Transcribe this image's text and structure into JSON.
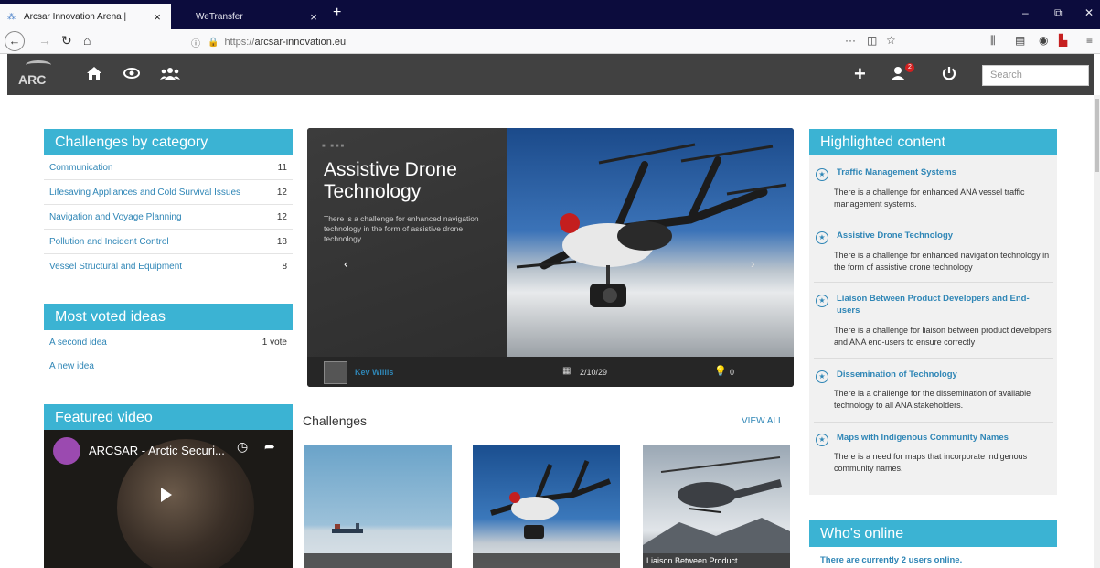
{
  "browser": {
    "tabs": [
      {
        "title": "Arcsar Innovation Arena |",
        "active": true
      },
      {
        "title": "WeTransfer",
        "active": false
      }
    ],
    "url_protocol": "https://",
    "url_host": "arcsar-innovation.eu",
    "url_more": "···"
  },
  "header": {
    "logo_text": "ARC",
    "search_placeholder": "Search",
    "notification_count": "2"
  },
  "categories": {
    "title": "Challenges by category",
    "items": [
      {
        "name": "Communication",
        "count": "11"
      },
      {
        "name": "Lifesaving Appliances and Cold Survival Issues",
        "count": "12"
      },
      {
        "name": "Navigation and Voyage Planning",
        "count": "12"
      },
      {
        "name": "Pollution and Incident Control",
        "count": "18"
      },
      {
        "name": "Vessel Structural and Equipment",
        "count": "8"
      }
    ]
  },
  "most_voted": {
    "title": "Most voted ideas",
    "items": [
      {
        "name": "A second idea",
        "votes": "1 vote"
      },
      {
        "name": "A new idea",
        "votes": ""
      }
    ]
  },
  "featured_video": {
    "title": "Featured video",
    "video_title": "ARCSAR - Arctic Securi..."
  },
  "carousel": {
    "title": "Assistive Drone Technology",
    "description": "There is a challenge for enhanced navigation technology in the form of assistive drone technology.",
    "user": "Kev Willis",
    "date": "2/10/29",
    "votes": "0"
  },
  "challenges": {
    "heading": "Challenges",
    "view_all": "VIEW ALL",
    "thumbs": [
      {
        "caption": ""
      },
      {
        "caption": ""
      },
      {
        "caption": "Liaison Between Product"
      }
    ]
  },
  "highlighted": {
    "title": "Highlighted content",
    "items": [
      {
        "title": "Traffic Management Systems",
        "desc": "There is a challenge for enhanced ANA vessel traffic management systems."
      },
      {
        "title": "Assistive Drone Technology",
        "desc": "There is a challenge for enhanced navigation technology in the form of assistive drone technology"
      },
      {
        "title": "Liaison Between Product Developers and End-users",
        "desc": "There is a challenge for liaison between product developers and ANA end-users to ensure correctly"
      },
      {
        "title": "Dissemination of Technology",
        "desc": "There ia a challenge for the dissemination of available technology to all ANA stakeholders."
      },
      {
        "title": "Maps with Indigenous Community Names",
        "desc": "There is a need for maps that incorporate indigenous community names."
      }
    ]
  },
  "whos_online": {
    "title": "Who's online",
    "text": "There are currently 2 users online."
  },
  "colors": {
    "accent": "#3bb3d3",
    "link": "#2f86b6",
    "header_bg": "#414141",
    "tabstrip_bg": "#0c0c3d"
  }
}
